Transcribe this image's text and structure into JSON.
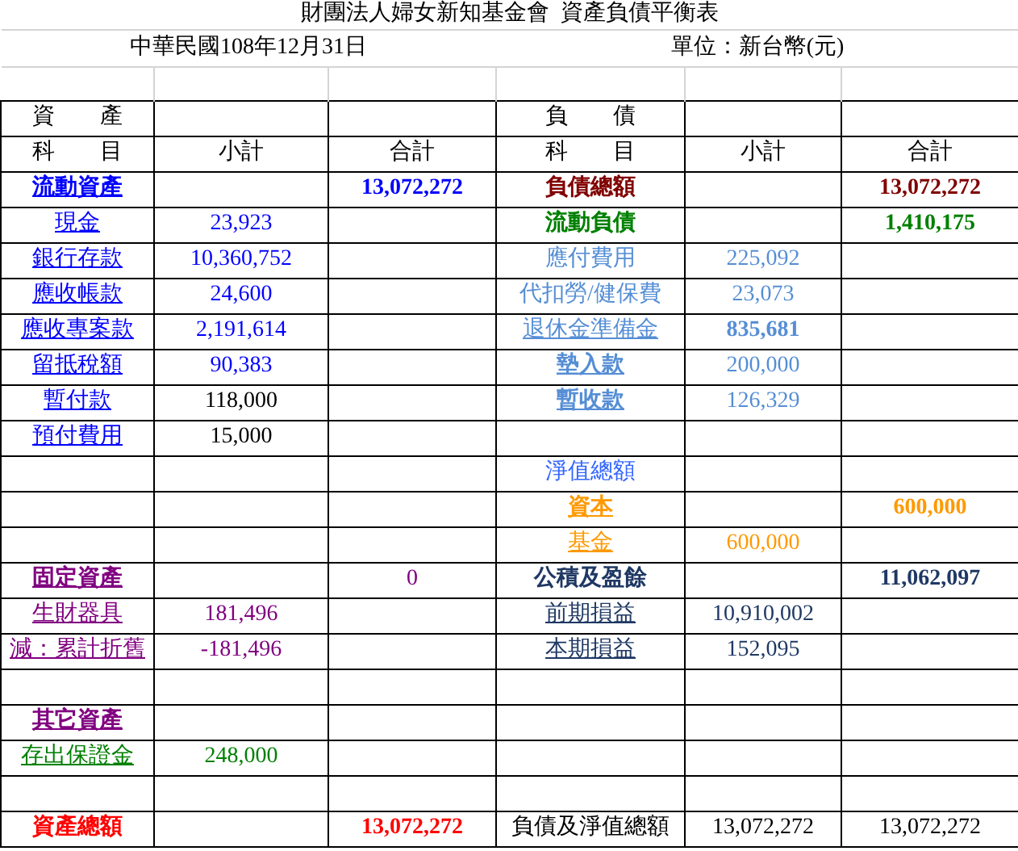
{
  "title": "財團法人婦女新知基金會  資產負債平衡表",
  "date": "中華民國108年12月31日",
  "unit": "單位：新台幣(元)",
  "headers": {
    "left": {
      "section": "資　　產",
      "subject": "科　　目",
      "subtotal": "小計",
      "total": "合計"
    },
    "right": {
      "section": "負　　債",
      "subject": "科　　目",
      "subtotal": "小計",
      "total": "合計"
    }
  },
  "rows": [
    {
      "left": {
        "label": "流動資產",
        "color": "#0000ff",
        "bold": true,
        "underline": true,
        "total": {
          "text": "13,072,272",
          "color": "#0000ff",
          "bold": true
        }
      },
      "right": {
        "label": "負債總額",
        "color": "#800000",
        "bold": true,
        "underline": false,
        "total": {
          "text": "13,072,272",
          "color": "#800000",
          "bold": true
        }
      }
    },
    {
      "left": {
        "label": "現金",
        "color": "#0000ff",
        "bold": false,
        "underline": true,
        "subtotal": {
          "text": "23,923",
          "color": "#0000ff",
          "bold": false
        }
      },
      "right": {
        "label": "流動負債",
        "color": "#008000",
        "bold": true,
        "underline": false,
        "total": {
          "text": "1,410,175",
          "color": "#008000",
          "bold": true
        }
      }
    },
    {
      "left": {
        "label": "銀行存款",
        "color": "#0000ff",
        "bold": false,
        "underline": true,
        "subtotal": {
          "text": "10,360,752",
          "color": "#0000ff",
          "bold": false
        }
      },
      "right": {
        "label": "應付費用",
        "color": "#558ed5",
        "bold": false,
        "underline": false,
        "subtotal": {
          "text": "225,092",
          "color": "#558ed5",
          "bold": false
        }
      }
    },
    {
      "left": {
        "label": "應收帳款",
        "color": "#0000ff",
        "bold": false,
        "underline": true,
        "subtotal": {
          "text": "24,600",
          "color": "#0000ff",
          "bold": false
        }
      },
      "right": {
        "label": "代扣勞/健保費",
        "color": "#558ed5",
        "bold": false,
        "underline": false,
        "subtotal": {
          "text": "23,073",
          "color": "#558ed5",
          "bold": false
        }
      }
    },
    {
      "left": {
        "label": "應收專案款",
        "color": "#0000ff",
        "bold": false,
        "underline": true,
        "subtotal": {
          "text": "2,191,614",
          "color": "#0000ff",
          "bold": false
        }
      },
      "right": {
        "label": "退休金準備金",
        "color": "#558ed5",
        "bold": false,
        "underline": true,
        "subtotal": {
          "text": "835,681",
          "color": "#558ed5",
          "bold": true
        }
      }
    },
    {
      "left": {
        "label": "留抵稅額",
        "color": "#0000ff",
        "bold": false,
        "underline": true,
        "subtotal": {
          "text": "90,383",
          "color": "#0000ff",
          "bold": false
        }
      },
      "right": {
        "label": "墊入款",
        "color": "#558ed5",
        "bold": true,
        "underline": true,
        "subtotal": {
          "text": "200,000",
          "color": "#558ed5",
          "bold": false
        }
      }
    },
    {
      "left": {
        "label": "暫付款",
        "color": "#0000ff",
        "bold": false,
        "underline": true,
        "subtotal": {
          "text": "118,000",
          "color": "#000000",
          "bold": false
        }
      },
      "right": {
        "label": "暫收款",
        "color": "#558ed5",
        "bold": true,
        "underline": true,
        "subtotal": {
          "text": "126,329",
          "color": "#558ed5",
          "bold": false
        }
      }
    },
    {
      "left": {
        "label": "預付費用",
        "color": "#0000ff",
        "bold": false,
        "underline": true,
        "subtotal": {
          "text": "15,000",
          "color": "#000000",
          "bold": false
        }
      }
    },
    {
      "right": {
        "label": "淨值總額",
        "color": "#3366ff",
        "bold": false,
        "underline": false
      }
    },
    {
      "right": {
        "label": "資本",
        "color": "#ff9900",
        "bold": true,
        "underline": true,
        "total": {
          "text": "600,000",
          "color": "#ff9900",
          "bold": true
        }
      }
    },
    {
      "right": {
        "label": "基金",
        "color": "#ff9900",
        "bold": false,
        "underline": true,
        "subtotal": {
          "text": "600,000",
          "color": "#ff9900",
          "bold": false
        }
      }
    },
    {
      "left": {
        "label": "固定資產",
        "color": "#800080",
        "bold": true,
        "underline": true,
        "total": {
          "text": "0",
          "color": "#800080",
          "bold": false
        }
      },
      "right": {
        "label": "公積及盈餘",
        "color": "#1f3864",
        "bold": true,
        "underline": false,
        "total": {
          "text": "11,062,097",
          "color": "#1f3864",
          "bold": true
        }
      }
    },
    {
      "left": {
        "label": "生財器具",
        "color": "#800080",
        "bold": false,
        "underline": true,
        "subtotal": {
          "text": "181,496",
          "color": "#800080",
          "bold": false
        }
      },
      "right": {
        "label": "前期損益",
        "color": "#1f3864",
        "bold": false,
        "underline": true,
        "subtotal": {
          "text": "10,910,002",
          "color": "#1f3864",
          "bold": false
        }
      }
    },
    {
      "left": {
        "label": "減：累計折舊",
        "color": "#800080",
        "bold": false,
        "underline": true,
        "subtotal": {
          "text": "-181,496",
          "color": "#800080",
          "bold": false
        }
      },
      "right": {
        "label": "本期損益",
        "color": "#1f3864",
        "bold": false,
        "underline": true,
        "subtotal": {
          "text": "152,095",
          "color": "#1f3864",
          "bold": false
        }
      }
    },
    {},
    {
      "left": {
        "label": "其它資產",
        "color": "#800080",
        "bold": true,
        "underline": true
      }
    },
    {
      "left": {
        "label": "存出保證金",
        "color": "#008000",
        "bold": false,
        "underline": true,
        "subtotal": {
          "text": "248,000",
          "color": "#008000",
          "bold": false
        }
      }
    },
    {},
    {
      "left": {
        "label": "資產總額",
        "color": "#ff0000",
        "bold": true,
        "underline": false,
        "total": {
          "text": "13,072,272",
          "color": "#ff0000",
          "bold": true
        }
      },
      "right": {
        "label": "負債及淨值總額",
        "color": "#000000",
        "bold": false,
        "underline": false,
        "subtotal": {
          "text": "13,072,272",
          "color": "#000000",
          "bold": false
        },
        "total": {
          "text": "13,072,272",
          "color": "#000000",
          "bold": false
        }
      }
    }
  ]
}
